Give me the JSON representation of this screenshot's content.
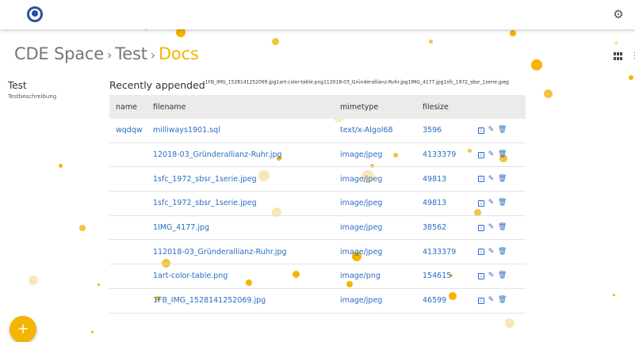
{
  "header": {
    "logo_icon": "cde-logo-icon",
    "settings_icon": "gear-icon"
  },
  "breadcrumb": {
    "items": [
      "CDE Space",
      "Test",
      "Docs"
    ],
    "separator": "›"
  },
  "sidebar": {
    "title": "Test",
    "description": "Testbeschreibung"
  },
  "recent": {
    "label": "Recently appended",
    "files": "1FB_IMG_1528141252069.jpg1art-color-table.png112018-03_Gründerallianz-Ruhr.jpg1IMG_4177.jpg1sfc_1972_sbsr_1serie.jpeg"
  },
  "table": {
    "headers": [
      "name",
      "filename",
      "mimetype",
      "filesize"
    ],
    "rows": [
      {
        "name": "wqdqw",
        "filename": "milliways1901.sql",
        "mimetype": "text/x-Algol68",
        "filesize": "3596"
      },
      {
        "name": "",
        "filename": "12018-03_Gründerallianz-Ruhr.jpg",
        "mimetype": "image/jpeg",
        "filesize": "4133379"
      },
      {
        "name": "",
        "filename": "1sfc_1972_sbsr_1serie.jpeg",
        "mimetype": "image/jpeg",
        "filesize": "49813"
      },
      {
        "name": "",
        "filename": "1sfc_1972_sbsr_1serie.jpeg",
        "mimetype": "image/jpeg",
        "filesize": "49813"
      },
      {
        "name": "",
        "filename": "1IMG_4177.jpg",
        "mimetype": "image/jpeg",
        "filesize": "38562"
      },
      {
        "name": "",
        "filename": "112018-03_Gründerallianz-Ruhr.jpg",
        "mimetype": "image/jpeg",
        "filesize": "4133379"
      },
      {
        "name": "",
        "filename": "1art-color-table.png",
        "mimetype": "image/png",
        "filesize": "154615"
      },
      {
        "name": "",
        "filename": "1FB_IMG_1528141252069.jpg",
        "mimetype": "image/jpeg",
        "filesize": "46599"
      }
    ]
  },
  "fab": {
    "label": "+"
  },
  "colors": {
    "accent": "#f4b400",
    "link": "#2a6cc4"
  }
}
